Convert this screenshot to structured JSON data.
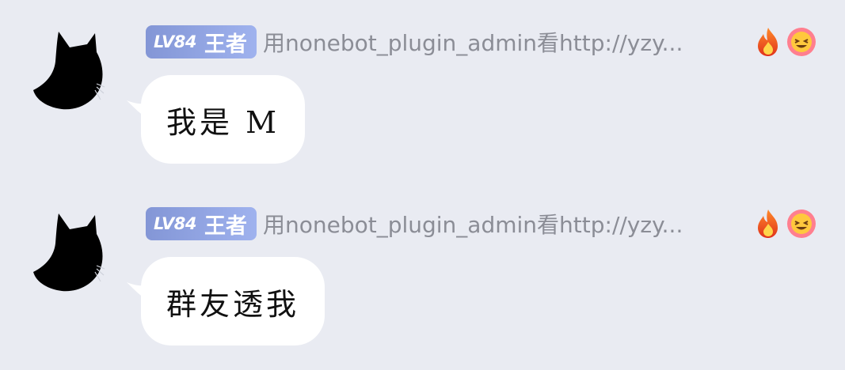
{
  "messages": [
    {
      "level_badge": "LV84",
      "rank_title": "王者",
      "nickname": "用nonebot_plugin_admin看http://yzy...",
      "emojis": [
        "fire-icon",
        "laughing-face-icon"
      ],
      "text": "我是 M"
    },
    {
      "level_badge": "LV84",
      "rank_title": "王者",
      "nickname": "用nonebot_plugin_admin看http://yzy...",
      "emojis": [
        "fire-icon",
        "laughing-face-icon"
      ],
      "text": "群友透我"
    }
  ],
  "colors": {
    "background": "#e9ebf2",
    "badge_start": "#8396d6",
    "badge_end": "#9fb2ee",
    "bubble": "#ffffff",
    "nickname": "#8b8d96"
  }
}
